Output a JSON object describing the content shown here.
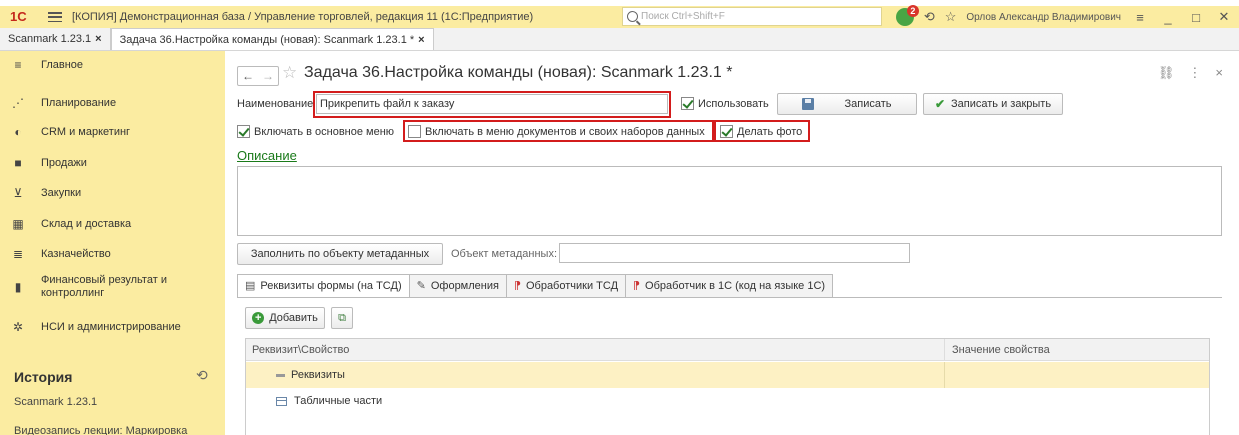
{
  "titlebar": {
    "logo": "1С",
    "title": "[КОПИЯ] Демонстрационная база / Управление торговлей, редакция 11  (1С:Предприятие)",
    "search_placeholder": "Поиск Ctrl+Shift+F",
    "notification_count": "2",
    "user": "Орлов Александр Владимирович",
    "colors": {
      "bar": "#fbeca1",
      "badge": "#d9342b",
      "bell": "#49a544"
    }
  },
  "window_tabs": [
    {
      "label": "Scanmark 1.23.1",
      "close": "×"
    },
    {
      "label": "Задача 36.Настройка команды (новая): Scanmark 1.23.1 *",
      "close": "×"
    }
  ],
  "sidebar": {
    "items": [
      {
        "label": "Главное",
        "icon": "menu-lines-icon"
      },
      {
        "label": "Планирование",
        "icon": "planning-icon"
      },
      {
        "label": "CRM и маркетинг",
        "icon": "crm-icon"
      },
      {
        "label": "Продажи",
        "icon": "sales-bag-icon"
      },
      {
        "label": "Закупки",
        "icon": "cart-icon"
      },
      {
        "label": "Склад и доставка",
        "icon": "warehouse-icon"
      },
      {
        "label": "Казначейство",
        "icon": "treasury-icon"
      },
      {
        "label": "Финансовый результат и контроллинг",
        "icon": "bar-chart-icon"
      },
      {
        "label": "НСИ и администрирование",
        "icon": "gear-icon"
      }
    ],
    "history_title": "История",
    "history_items": [
      "Scanmark 1.23.1",
      "Видеозапись лекции: Маркировка"
    ]
  },
  "form": {
    "title": "Задача 36.Настройка команды (новая): Scanmark 1.23.1 *",
    "name_label": "Наименование",
    "name_value": "Прикрепить файл к заказу",
    "use_label": "Использовать",
    "save_label": "Записать",
    "save_close_label": "Записать и закрыть",
    "main_menu_label": "Включать в основное меню",
    "doc_menu_label": "Включать в меню документов и своих наборов данных",
    "photo_label": "Делать фото",
    "description_link": "Описание",
    "fill_button": "Заполнить по объекту метаданных",
    "metadata_label": "Объект метаданных:",
    "metadata_value": "",
    "checks": {
      "use": true,
      "main_menu": true,
      "doc_menu": false,
      "photo": true
    },
    "highlight_color": "#d31c1c"
  },
  "form_tabs": [
    {
      "label": "Реквизиты формы (на ТСД)",
      "icon": "form-icon"
    },
    {
      "label": "Оформления",
      "icon": "brush-icon"
    },
    {
      "label": "Обработчики ТСД",
      "icon": "handler-icon"
    },
    {
      "label": "Обработчик в 1С  (код на языке 1С)",
      "icon": "handler-1c-icon"
    }
  ],
  "grid": {
    "add_label": "Добавить",
    "columns": [
      "Реквизит\\Свойство",
      "Значение свойства"
    ],
    "rows": [
      {
        "name": "Реквизиты",
        "value": "",
        "selected": true
      },
      {
        "name": "Табличные части",
        "value": "",
        "selected": false
      }
    ]
  }
}
